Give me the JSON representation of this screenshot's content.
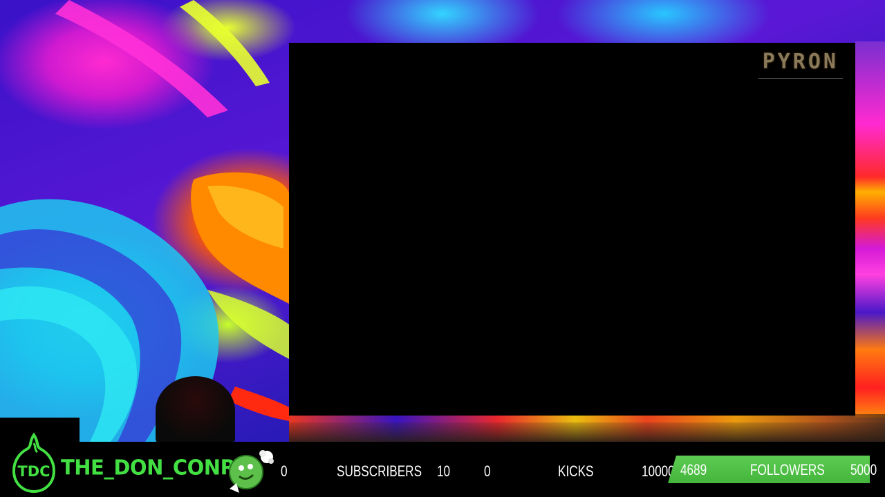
{
  "overlay": {
    "brand_watermark": "PYRON",
    "channel_name": "THE_DON_CONRY",
    "logo_text": "TDC"
  },
  "stats": {
    "subscribers": {
      "current": "0",
      "label": "SUBSCRIBERS",
      "goal": "10"
    },
    "kicks": {
      "current": "0",
      "label": "KICKS",
      "goal": "10000"
    },
    "followers": {
      "current": "4689",
      "label": "FOLLOWERS",
      "goal": "5000",
      "progress": 0.9378
    }
  },
  "colors": {
    "channel_green": "#43e043",
    "progress_green": "#4cbf44",
    "background": "#000000"
  },
  "icons": [
    "tdc-logo-icon",
    "mascot-icon"
  ]
}
